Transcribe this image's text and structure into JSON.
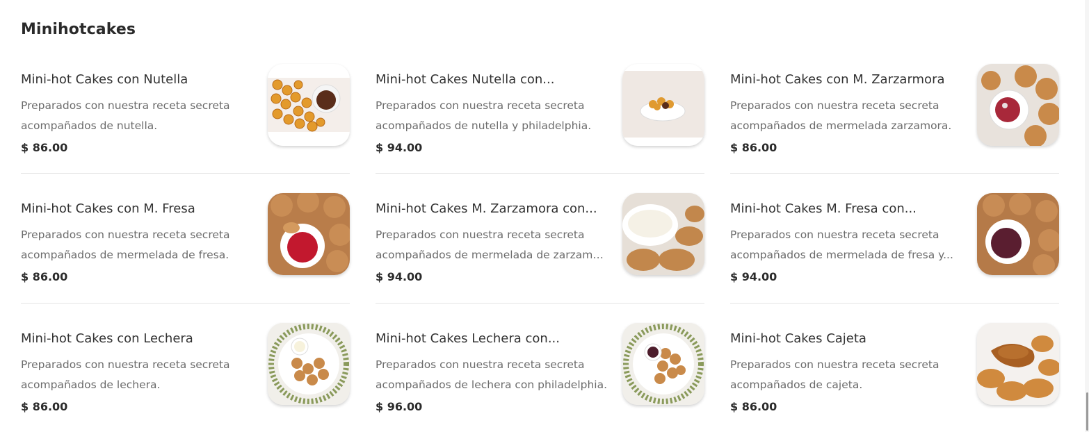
{
  "section": {
    "title": "Minihotcakes"
  },
  "items": [
    {
      "name": "Mini-hot Cakes con Nutella",
      "desc1": "Preparados con nuestra receta secreta",
      "desc2": "acompañados de nutella.",
      "price": "$ 86.00",
      "image": "nutella-hotcakes-image"
    },
    {
      "name": "Mini-hot Cakes Nutella con...",
      "desc1": "Preparados con nuestra receta secreta",
      "desc2": "acompañados de nutella y philadelphia.",
      "price": "$ 94.00",
      "image": "nutella-philadelphia-hotcakes-image"
    },
    {
      "name": "Mini-hot Cakes con M. Zarzarmora",
      "desc1": "Preparados con nuestra receta secreta",
      "desc2": "acompañados de mermelada zarzamora.",
      "price": "$ 86.00",
      "image": "zarzamora-hotcakes-image"
    },
    {
      "name": "Mini-hot Cakes con M. Fresa",
      "desc1": "Preparados con nuestra receta secreta",
      "desc2": "acompañados de mermelada de fresa.",
      "price": "$ 86.00",
      "image": "fresa-hotcakes-image"
    },
    {
      "name": "Mini-hot Cakes M. Zarzamora con...",
      "desc1": "Preparados con nuestra receta secreta",
      "desc2": "acompañados de mermelada de zarzamor...",
      "price": "$ 94.00",
      "image": "zarzamora-philadelphia-hotcakes-image"
    },
    {
      "name": "Mini-hot Cakes M. Fresa con...",
      "desc1": "Preparados con nuestra receta secreta",
      "desc2": "acompañados de mermelada de fresa y...",
      "price": "$ 94.00",
      "image": "fresa-philadelphia-hotcakes-image"
    },
    {
      "name": "Mini-hot Cakes con Lechera",
      "desc1": "Preparados con nuestra receta secreta",
      "desc2": "acompañados de lechera.",
      "price": "$ 86.00",
      "image": "lechera-hotcakes-image"
    },
    {
      "name": "Mini-hot Cakes Lechera con...",
      "desc1": "Preparados con nuestra receta secreta",
      "desc2": "acompañados de lechera con philadelphia.",
      "price": "$ 96.00",
      "image": "lechera-philadelphia-hotcakes-image"
    },
    {
      "name": "Mini-hot Cakes Cajeta",
      "desc1": "Preparados con nuestra receta secreta",
      "desc2": "acompañados de cajeta.",
      "price": "$ 86.00",
      "image": "cajeta-hotcakes-image"
    }
  ]
}
